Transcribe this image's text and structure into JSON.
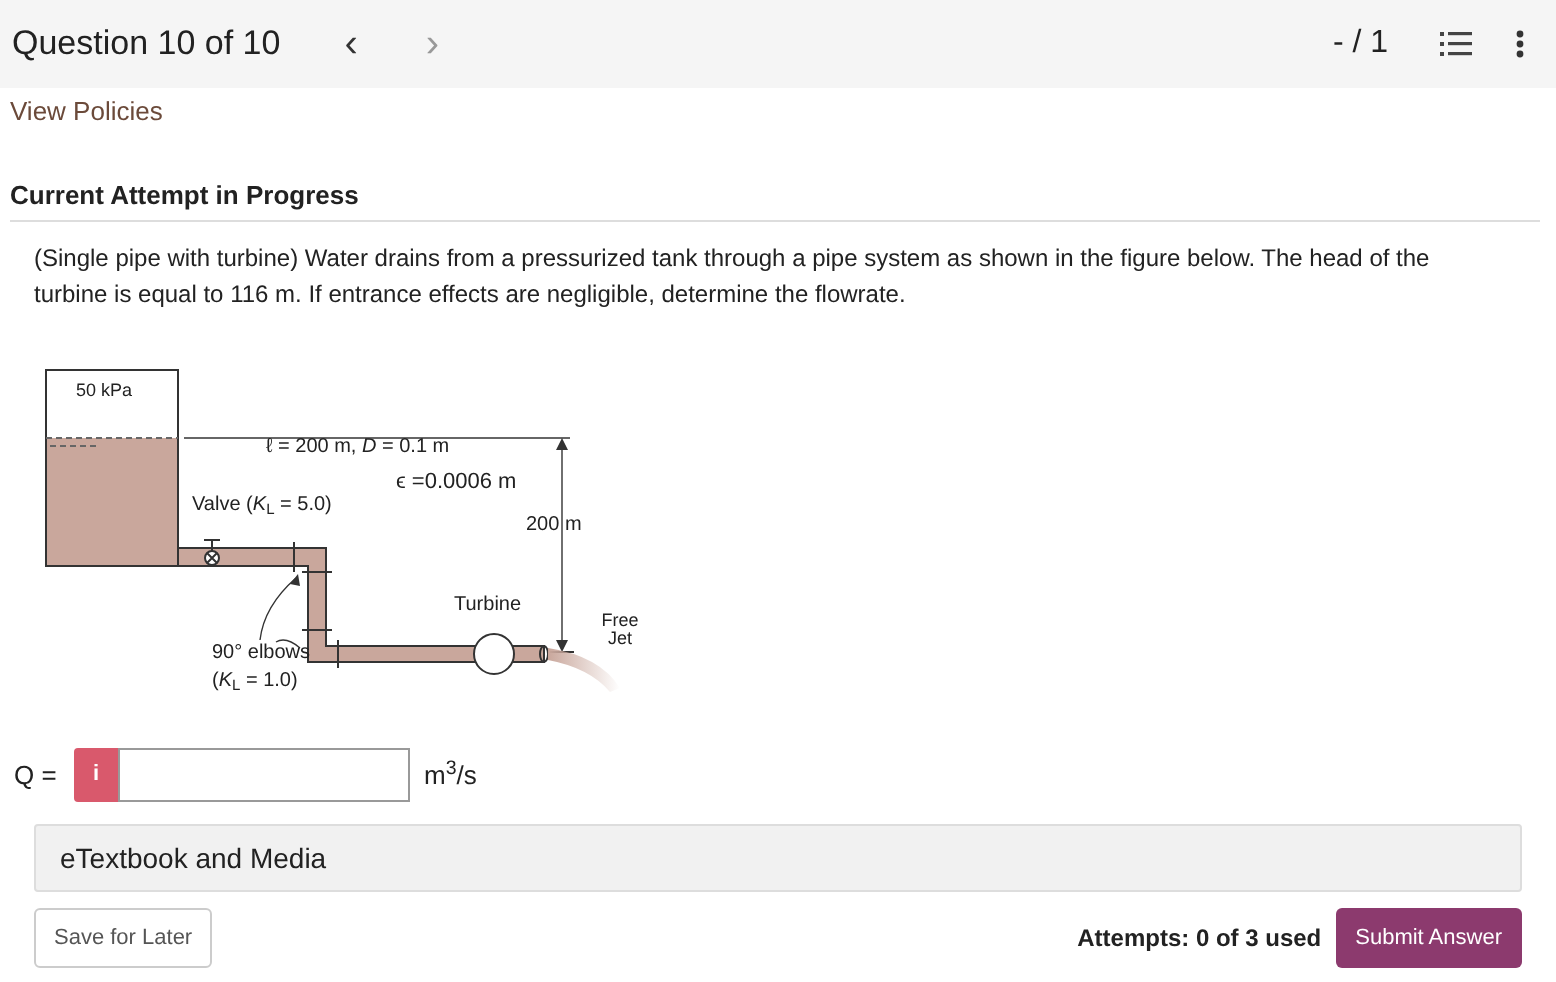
{
  "header": {
    "title": "Question 10 of 10",
    "prev": "‹",
    "next": "›",
    "score": "- / 1"
  },
  "policies_link": "View Policies",
  "attempt_heading": "Current Attempt in Progress",
  "question": "(Single pipe with turbine) Water drains from a pressurized tank through a pipe system as shown in the figure below. The head of the turbine is equal to 116 m. If entrance effects are negligible, determine the flowrate.",
  "figure": {
    "labels": [
      {
        "kind": "pressure",
        "text": "50 kPa"
      },
      {
        "kind": "pipe",
        "text": "ℓ = 200 m, *D* = 0.1 m"
      },
      {
        "kind": "roughness",
        "text": "ϵ =0.0006 m"
      },
      {
        "kind": "valve",
        "text": "Valve (*K*$_{L}$ = 5.0)"
      },
      {
        "kind": "height",
        "text": "200 m"
      },
      {
        "kind": "turbine",
        "text": "Turbine"
      },
      {
        "kind": "jet",
        "text": "Free Jet"
      },
      {
        "kind": "elbows",
        "text": "90° elbows"
      },
      {
        "kind": "elbow_k",
        "text": "(*K*$_{L}$ = 1.0)"
      }
    ]
  },
  "answer": {
    "label": "Q =",
    "info": "i",
    "unit": "m$^{3}$/s"
  },
  "media_panel": "eTextbook and Media",
  "save_button": "Save for Later",
  "attempts": "Attempts: 0 of 3 used",
  "submit_button": "Submit Answer"
}
